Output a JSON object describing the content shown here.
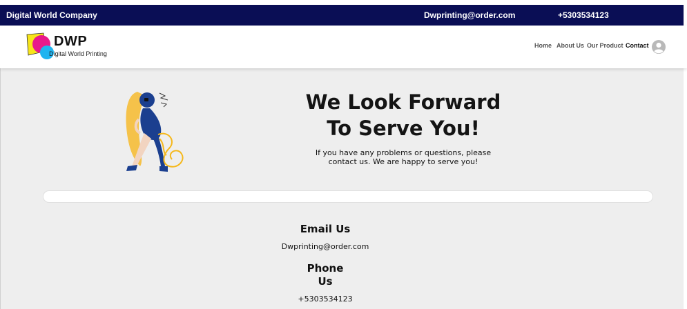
{
  "topbar": {
    "company": "Digital World Company",
    "email": "Dwprinting@order.com",
    "phone": "+5303534123"
  },
  "header": {
    "logo_text": "DWP",
    "logo_subtitle": "Digital World Printing",
    "nav": [
      "Home",
      "About Us",
      "Our Product",
      "Contact"
    ],
    "active_nav": "Contact"
  },
  "hero": {
    "title_line1": "We Look Forward",
    "title_line2": "To Serve You!",
    "description_line1": "If you have any problems or questions, please",
    "description_line2": "contact us. We are happy to serve you!"
  },
  "contact": {
    "email_title": "Email Us",
    "email_value": "Dwprinting@order.com",
    "phone_title_line1": "Phone",
    "phone_title_line2": "Us",
    "phone_value": "+5303534123"
  },
  "colors": {
    "topbar_bg": "#0a0e55",
    "page_bg": "#eeeeee",
    "logo_pink": "#e8198b",
    "logo_cyan": "#1eb4f0",
    "logo_yellow": "#f7e51a",
    "illustration_yellow": "#f5c24a",
    "illustration_blue": "#1b3f8f"
  },
  "icons": {
    "avatar": "user-avatar-icon",
    "illustration": "person-on-phone-illustration"
  }
}
